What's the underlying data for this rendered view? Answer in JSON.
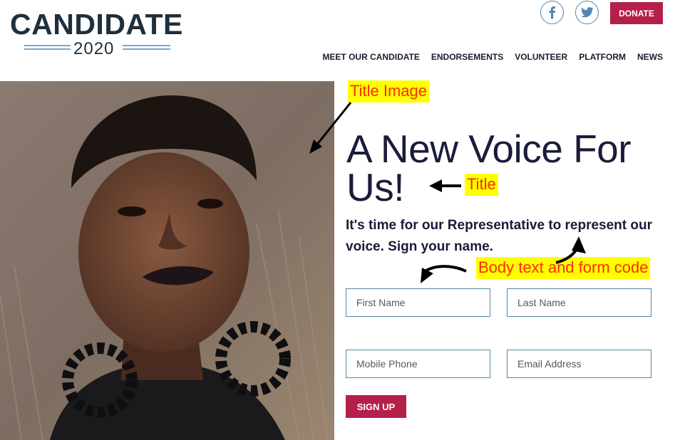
{
  "logo": {
    "wordmark": "CANDIDATE",
    "year": "2020"
  },
  "header": {
    "social_icons": [
      "facebook-icon",
      "twitter-icon"
    ],
    "donate_label": "DONATE",
    "nav": [
      "MEET OUR CANDIDATE",
      "ENDORSEMENTS",
      "VOLUNTEER",
      "PLATFORM",
      "NEWS"
    ]
  },
  "hero": {
    "title": "A New Voice For Us!",
    "body": "It's time for our Representative to represent our voice. Sign your name."
  },
  "form": {
    "first_name_placeholder": "First Name",
    "last_name_placeholder": "Last Name",
    "mobile_phone_placeholder": "Mobile Phone",
    "email_placeholder": "Email Address",
    "signup_label": "SIGN UP"
  },
  "annotations": {
    "title_image": "Title Image",
    "title": "Title",
    "body_form": "Body text and form code"
  },
  "colors": {
    "accent": "#b5204a",
    "navy": "#1f2f3c",
    "social_blue": "#4f84b7",
    "annotation_bg": "#ffff00",
    "annotation_text": "#ff2a00"
  }
}
